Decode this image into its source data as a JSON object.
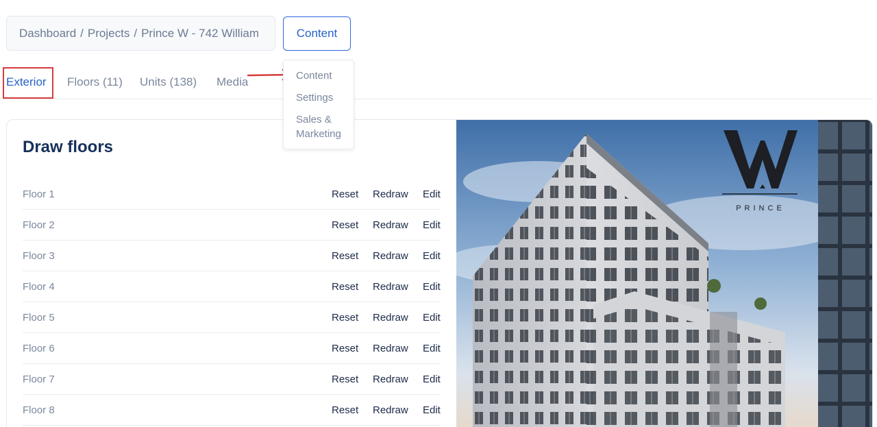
{
  "breadcrumb": {
    "items": [
      "Dashboard",
      "Projects",
      "Prince W - 742 William"
    ],
    "separator": "/"
  },
  "header": {
    "content_button_label": "Content"
  },
  "tabs": [
    {
      "label": "Exterior",
      "active": true
    },
    {
      "label": "Floors (11)",
      "active": false
    },
    {
      "label": "Units (138)",
      "active": false
    },
    {
      "label": "Media",
      "active": false
    }
  ],
  "dropdown": {
    "items": [
      "Content",
      "Settings",
      "Sales &",
      "Marketing"
    ]
  },
  "card": {
    "title": "Draw floors",
    "actions": {
      "reset": "Reset",
      "redraw": "Redraw",
      "edit": "Edit"
    },
    "floors": [
      "Floor 1",
      "Floor 2",
      "Floor 3",
      "Floor 4",
      "Floor 5",
      "Floor 6",
      "Floor 7",
      "Floor 8"
    ]
  },
  "photo": {
    "logo_text": "PRINCE"
  },
  "colors": {
    "accent": "#2563c9",
    "highlight": "#d63c3c",
    "title": "#16305a",
    "muted": "#7a879c"
  }
}
